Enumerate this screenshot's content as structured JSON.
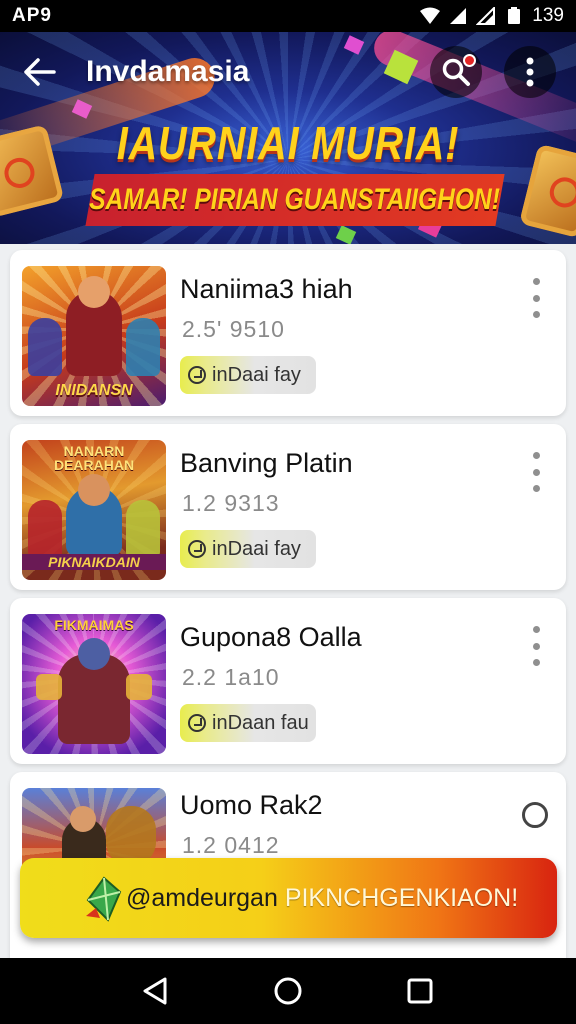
{
  "status_bar": {
    "carrier": "AP9",
    "time": "139",
    "icons": [
      "wifi-icon",
      "signal-icon",
      "signal-icon",
      "battery-icon"
    ]
  },
  "header": {
    "title": "Invdamasia",
    "back_icon": "back-arrow-icon",
    "search_icon": "search-icon",
    "menu_icon": "more-vertical-icon",
    "banner_headline": "IAURNIAI MURIA!",
    "banner_subline": "SAMAR! PIRIAN GUANSTAIIGHON!"
  },
  "games": [
    {
      "title": "Naniima3 hiah",
      "meta": "2.5' 9510",
      "badge": "inDaai  fay",
      "thumb_caption": "INIDANSN",
      "thumb_top": "",
      "action": "more"
    },
    {
      "title": "Banving Platin",
      "meta": "1.2 9313",
      "badge": "inDaai  fay",
      "thumb_caption": "PIKNAIKDAIN",
      "thumb_top": "NANARN DEARAHAN",
      "action": "more"
    },
    {
      "title": "Gupona8 Oalla",
      "meta": "2.2 1a10",
      "badge": "inDaan  fau",
      "thumb_caption": "",
      "thumb_top": "FIKMAIMAS",
      "action": "more"
    },
    {
      "title": "Uomo Rak2",
      "meta": "1.2 0412",
      "badge": "",
      "thumb_caption": "",
      "thumb_top": "",
      "action": "radio"
    }
  ],
  "promo": {
    "text_dark": "@amdeurgan",
    "text_light": "PIKNCHGENKIAON!",
    "icon": "gem-icon"
  },
  "nav": {
    "back_icon": "nav-back-icon",
    "home_icon": "nav-home-icon",
    "recents_icon": "nav-recents-icon"
  },
  "colors": {
    "accent_yellow": "#ffd21c",
    "banner_red": "#c8212e",
    "banner_blue": "#1f2f8f"
  }
}
